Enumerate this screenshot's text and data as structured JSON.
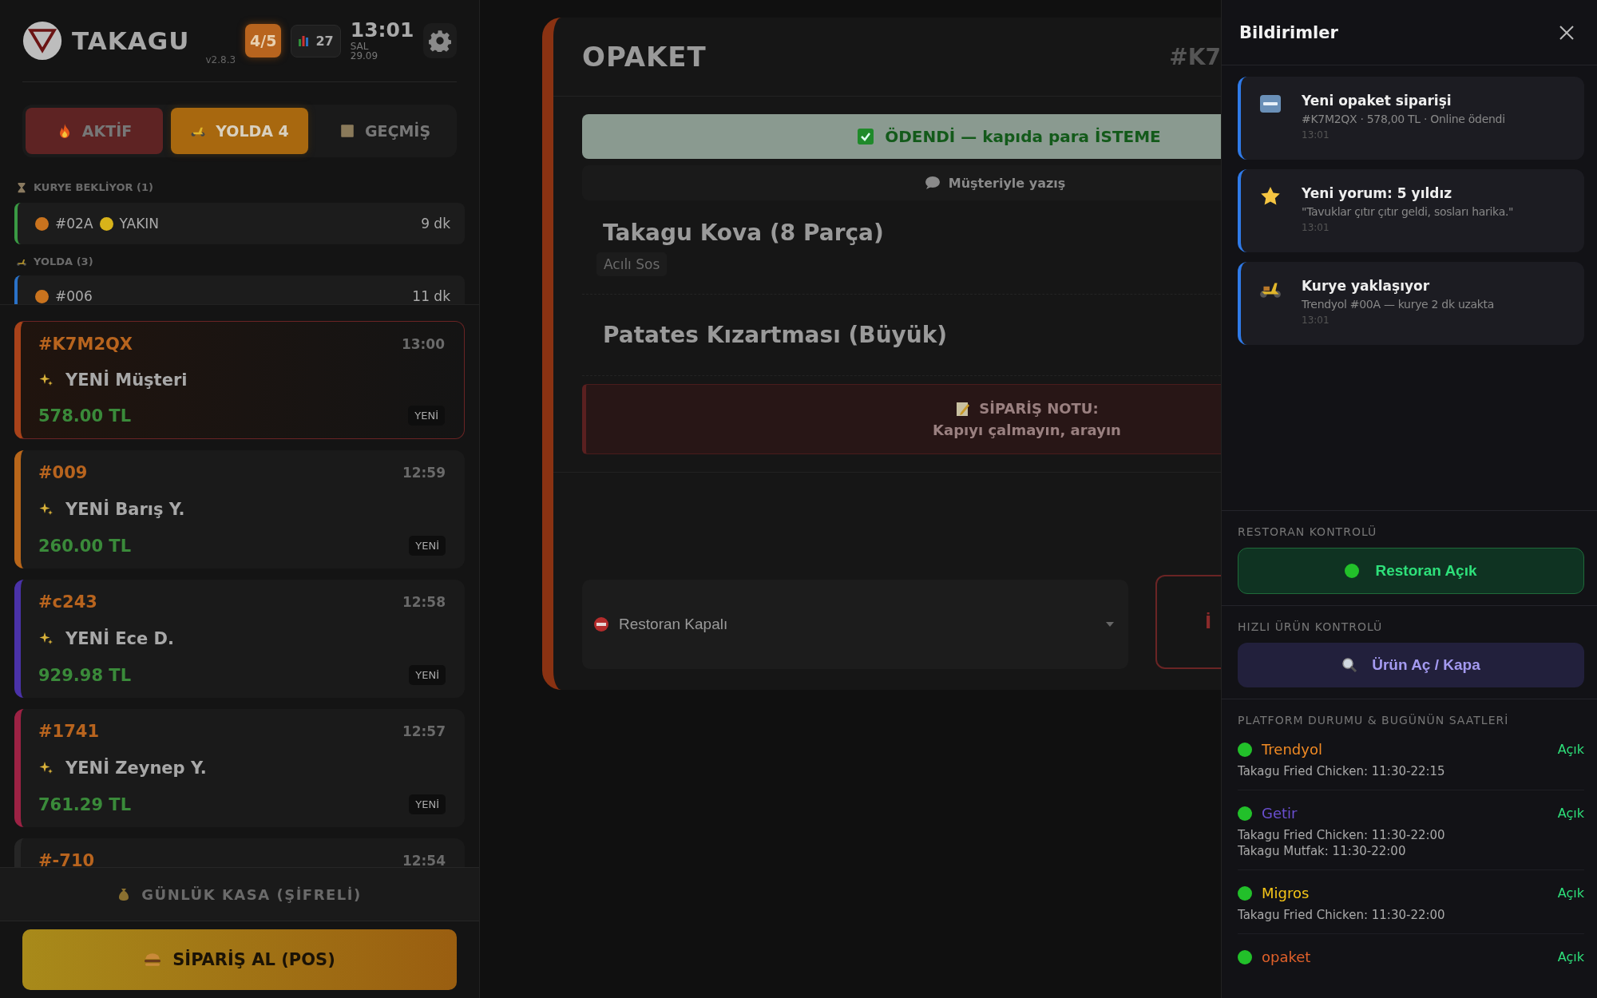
{
  "header": {
    "brand": "TAKAGU",
    "version": "v2.8.3",
    "capacity": "4/5",
    "order_count": "27",
    "time": "13:01",
    "day": "SAL",
    "date": "29.09"
  },
  "tabs": [
    {
      "label": "AKTİF",
      "color": "#5e2323",
      "selected": false
    },
    {
      "label": "YOLDA 4",
      "color": "#a8680f",
      "selected": true
    },
    {
      "label": "GEÇMİŞ",
      "selected": false
    }
  ],
  "courier_sections": [
    {
      "title": "KURYE BEKLİYOR (1)",
      "rows": [
        {
          "code": "#02A",
          "color": "#3a9a44",
          "marker": {
            "color": "#c9731e"
          },
          "proximity": {
            "label": "YAKIN",
            "color": "#d8b31a"
          },
          "eta": "9 dk"
        }
      ]
    },
    {
      "title": "YOLDA (3)",
      "rows": [
        {
          "code": "#006",
          "color": "#2a72c8",
          "marker": {
            "color": "#c9731e"
          },
          "eta": "11 dk"
        }
      ]
    }
  ],
  "orders": [
    {
      "id": "#K7M2QX",
      "time": "13:00",
      "title": "YENİ Müşteri",
      "total": "578.00 TL",
      "badge": "YENİ",
      "color": "#a8421a",
      "selected": true
    },
    {
      "id": "#009",
      "time": "12:59",
      "title": "YENİ Barış Y.",
      "total": "260.00 TL",
      "badge": "YENİ",
      "color": "#b8661a",
      "selected": false
    },
    {
      "id": "#c243",
      "time": "12:58",
      "title": "YENİ Ece D.",
      "total": "929.98 TL",
      "badge": "YENİ",
      "color": "#4a32a8",
      "selected": false
    },
    {
      "id": "#1741",
      "time": "12:57",
      "title": "YENİ Zeynep Y.",
      "total": "761.29 TL",
      "badge": "YENİ",
      "color": "#9c2244",
      "selected": false
    },
    {
      "id": "#-710",
      "time": "12:54",
      "color": "#262626",
      "selected": false
    }
  ],
  "cash_register": "GÜNLÜK KASA (ŞİFRELİ)",
  "pos_button": "SİPARİŞ AL (POS)",
  "detail": {
    "platform": "OPAKET",
    "order_id": "#K7",
    "payment_banner": "ÖDENDİ — kapıda para İSTEME",
    "chat_button": "Müşteriyle yazış",
    "items": [
      {
        "name": "Takagu Kova (8 Parça)",
        "options": [
          "Acılı Sos"
        ]
      },
      {
        "name": "Patates Kızartması (Büyük)"
      }
    ],
    "note": {
      "title": "SİPARİŞ NOTU:",
      "text": "Kapıyı çalmayın, arayın"
    },
    "status_select": {
      "value": "Restoran Kapalı"
    },
    "action_button": "İ"
  },
  "drawer": {
    "title": "Bildirimler",
    "notifications": [
      {
        "title": "Yeni opaket siparişi",
        "body": "#K7M2QX · 578,00 TL · Online ödendi",
        "time": "13:01"
      },
      {
        "title": "Yeni yorum: 5 yıldız",
        "body": "\"Tavuklar çıtır çıtır geldi, sosları harika.\"",
        "time": "13:01"
      },
      {
        "title": "Kurye yaklaşıyor",
        "body": "Trendyol #00A — kurye 2 dk uzakta",
        "time": "13:01"
      }
    ],
    "restaurant_control": {
      "label": "RESTORAN KONTROLÜ",
      "button": "Restoran Açık",
      "open": true
    },
    "product_control": {
      "label": "HIZLI ÜRÜN KONTROLÜ",
      "button": "Ürün Aç / Kapa"
    },
    "platforms": {
      "label": "PLATFORM DURUMU & BUGÜNÜN SAATLERİ",
      "items": [
        {
          "name": "Trendyol",
          "color": "#f08a24",
          "open": true,
          "status": "Açık",
          "hours": [
            "Takagu Fried Chicken: 11:30-22:15"
          ]
        },
        {
          "name": "Getir",
          "color": "#6a4fd0",
          "open": true,
          "status": "Açık",
          "hours": [
            "Takagu Fried Chicken: 11:30-22:00",
            "Takagu Mutfak: 11:30-22:00"
          ]
        },
        {
          "name": "Migros",
          "color": "#f5c518",
          "open": true,
          "status": "Açık",
          "hours": [
            "Takagu Fried Chicken: 11:30-22:00"
          ]
        },
        {
          "name": "opaket",
          "color": "#e0602a",
          "open": true,
          "status": "Açık"
        }
      ]
    }
  }
}
